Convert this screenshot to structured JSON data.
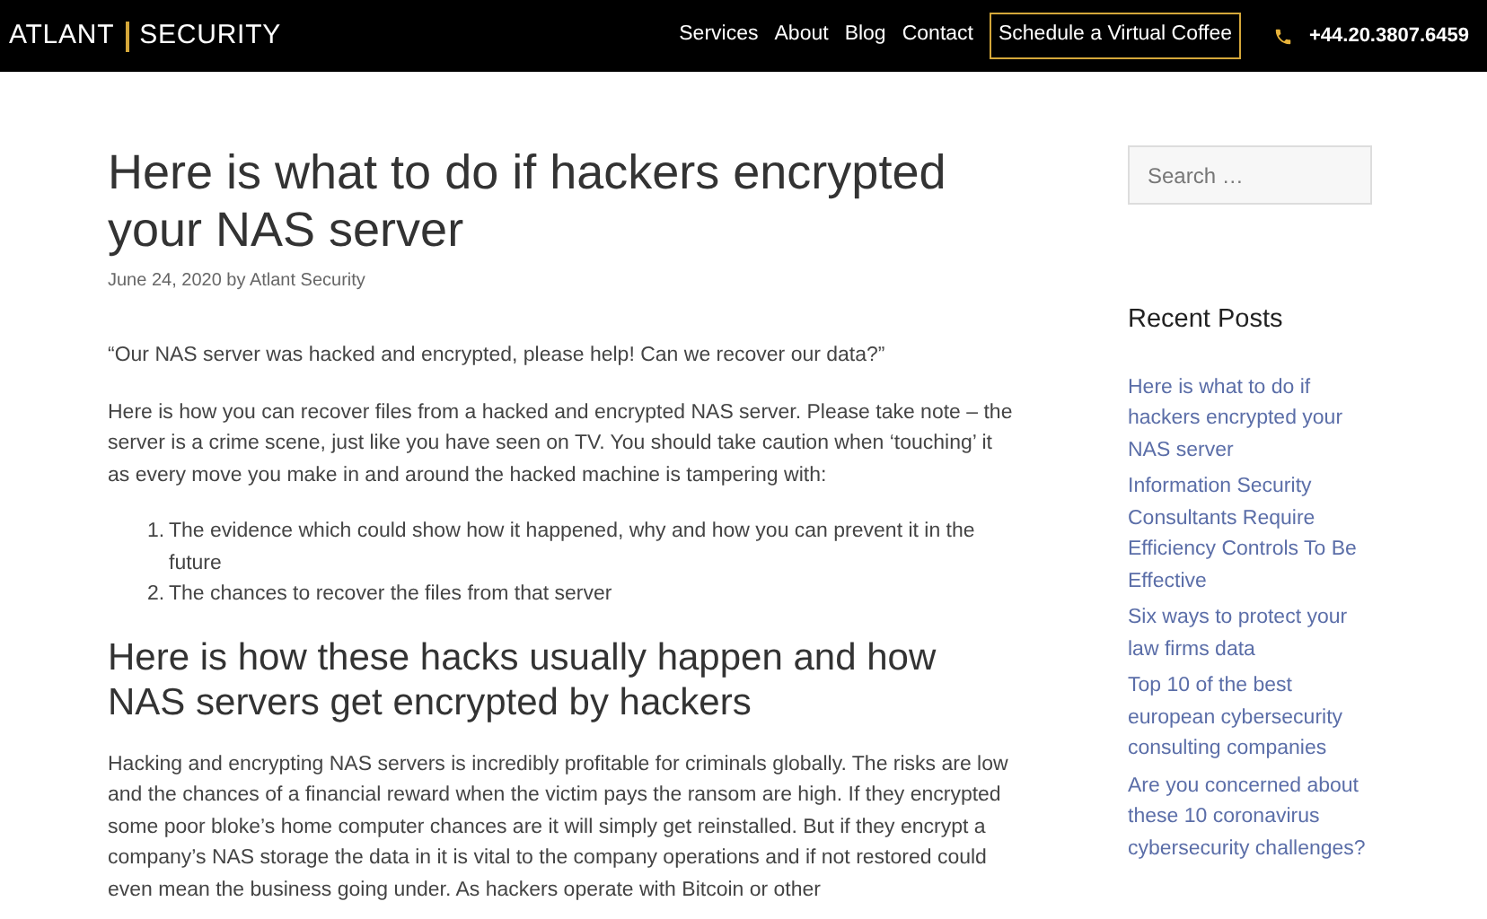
{
  "header": {
    "logo": [
      "ATLANT",
      "SECURITY"
    ],
    "nav": [
      {
        "label": "Services"
      },
      {
        "label": "About"
      },
      {
        "label": "Blog"
      },
      {
        "label": "Contact"
      }
    ],
    "cta": "Schedule a Virtual Coffee",
    "phone": "+44.20.3807.6459"
  },
  "article": {
    "title": "Here is what to do if hackers encrypted your NAS server",
    "meta": "June 24, 2020 by Atlant Security",
    "blocks": [
      {
        "kind": "paragraph",
        "text": "“Our NAS server was hacked and encrypted, please help! Can we recover our data?”"
      },
      {
        "kind": "paragraph",
        "text": "Here is how you can recover files from a hacked and encrypted NAS server. Please take note – the server is a crime scene, just like you have seen on TV. You should take caution when ‘touching’ it as every move you make in and around the hacked machine is tampering with:"
      },
      {
        "kind": "list",
        "items": [
          {
            "number": "1.",
            "text": "The evidence which could show how it happened, why and how you can prevent it in the future"
          },
          {
            "number": "2.",
            "text": "The chances to recover the files from that server"
          }
        ]
      },
      {
        "kind": "heading",
        "text": "Here is how these hacks usually happen and how NAS servers get encrypted by hackers"
      },
      {
        "kind": "paragraph",
        "text": "Hacking and encrypting NAS servers is incredibly profitable for criminals globally. The risks are low and the chances of a financial reward when the victim pays the ransom are high. If they encrypted some poor bloke’s home computer chances are it will simply get reinstalled. But if they encrypt a company’s NAS storage the data in it is vital to the company operations and if not restored could even mean the business going under. As hackers operate with Bitcoin or other"
      }
    ]
  },
  "sidebar": {
    "search": {
      "placeholder": "Search …"
    },
    "recent_title": "Recent Posts",
    "recent_posts": [
      "Here is what to do if hackers encrypted your NAS server",
      "Information Security Consultants Require Efficiency Controls To Be Effective",
      "Six ways to protect your law firms data",
      "Top 10 of the best european cybersecurity consulting companies",
      "Are you concerned about these 10 coronavirus cybersecurity challenges?"
    ]
  }
}
